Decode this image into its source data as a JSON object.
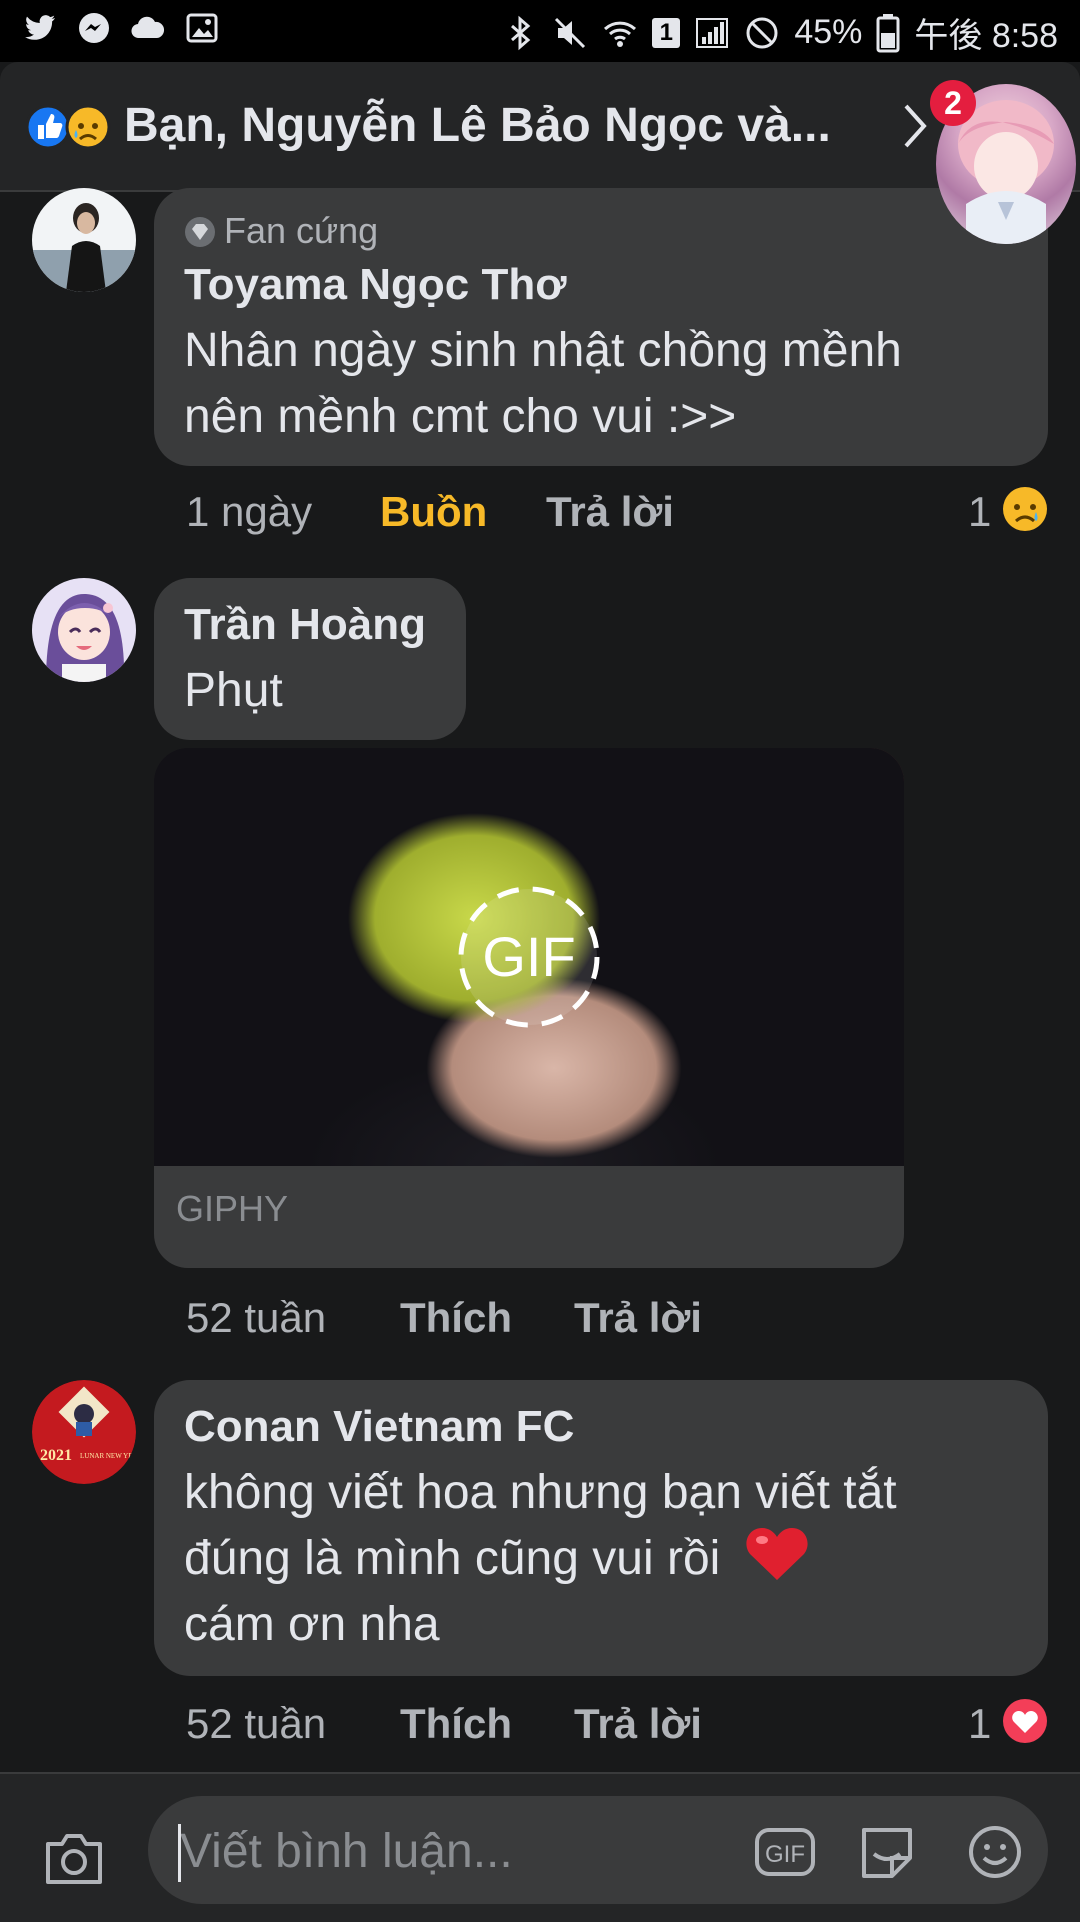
{
  "status_bar": {
    "battery_percent": "45%",
    "time": "午後 8:58",
    "sim_slot": "1"
  },
  "header": {
    "title": "Bạn, Nguyễn Lê Bảo Ngọc và...",
    "reactions": [
      "like",
      "sad"
    ],
    "chat_head_badge": "2"
  },
  "comments": [
    {
      "badge": "Fan cứng",
      "author": "Toyama Ngọc Thơ",
      "lines": [
        "Nhân ngày sinh nhật chồng mềnh",
        "nên mềnh cmt cho vui :>>"
      ],
      "time": "1 ngày",
      "reaction_label": "Buồn",
      "reply_label": "Trả lời",
      "reaction_count": "1",
      "reaction_icon": "sad-emoji"
    },
    {
      "author": "Trần Hoàng",
      "lines": [
        "Phụt"
      ],
      "gif_label": "GIF",
      "gif_source": "GIPHY",
      "time": "52 tuần",
      "reaction_label": "Thích",
      "reply_label": "Trả lời"
    },
    {
      "author": "Conan Vietnam FC",
      "lines": [
        "không viết hoa nhưng bạn viết tắt",
        "đúng là mình cũng vui rồi",
        "cám ơn nha"
      ],
      "time": "52 tuần",
      "reaction_label": "Thích",
      "reply_label": "Trả lời",
      "reaction_count": "1",
      "reaction_icon": "love-heart"
    }
  ],
  "avatar_text": {
    "conan_year": "2021",
    "conan_caption": "LUNAR NEW YEAR"
  },
  "composer": {
    "placeholder": "Viết bình luận...",
    "gif_button": "GIF"
  },
  "colors": {
    "background": "#18191a",
    "bubble": "#3a3b3c",
    "reacted_sad": "#f7b928",
    "love": "#f33e58",
    "badge": "#e41e3f"
  }
}
